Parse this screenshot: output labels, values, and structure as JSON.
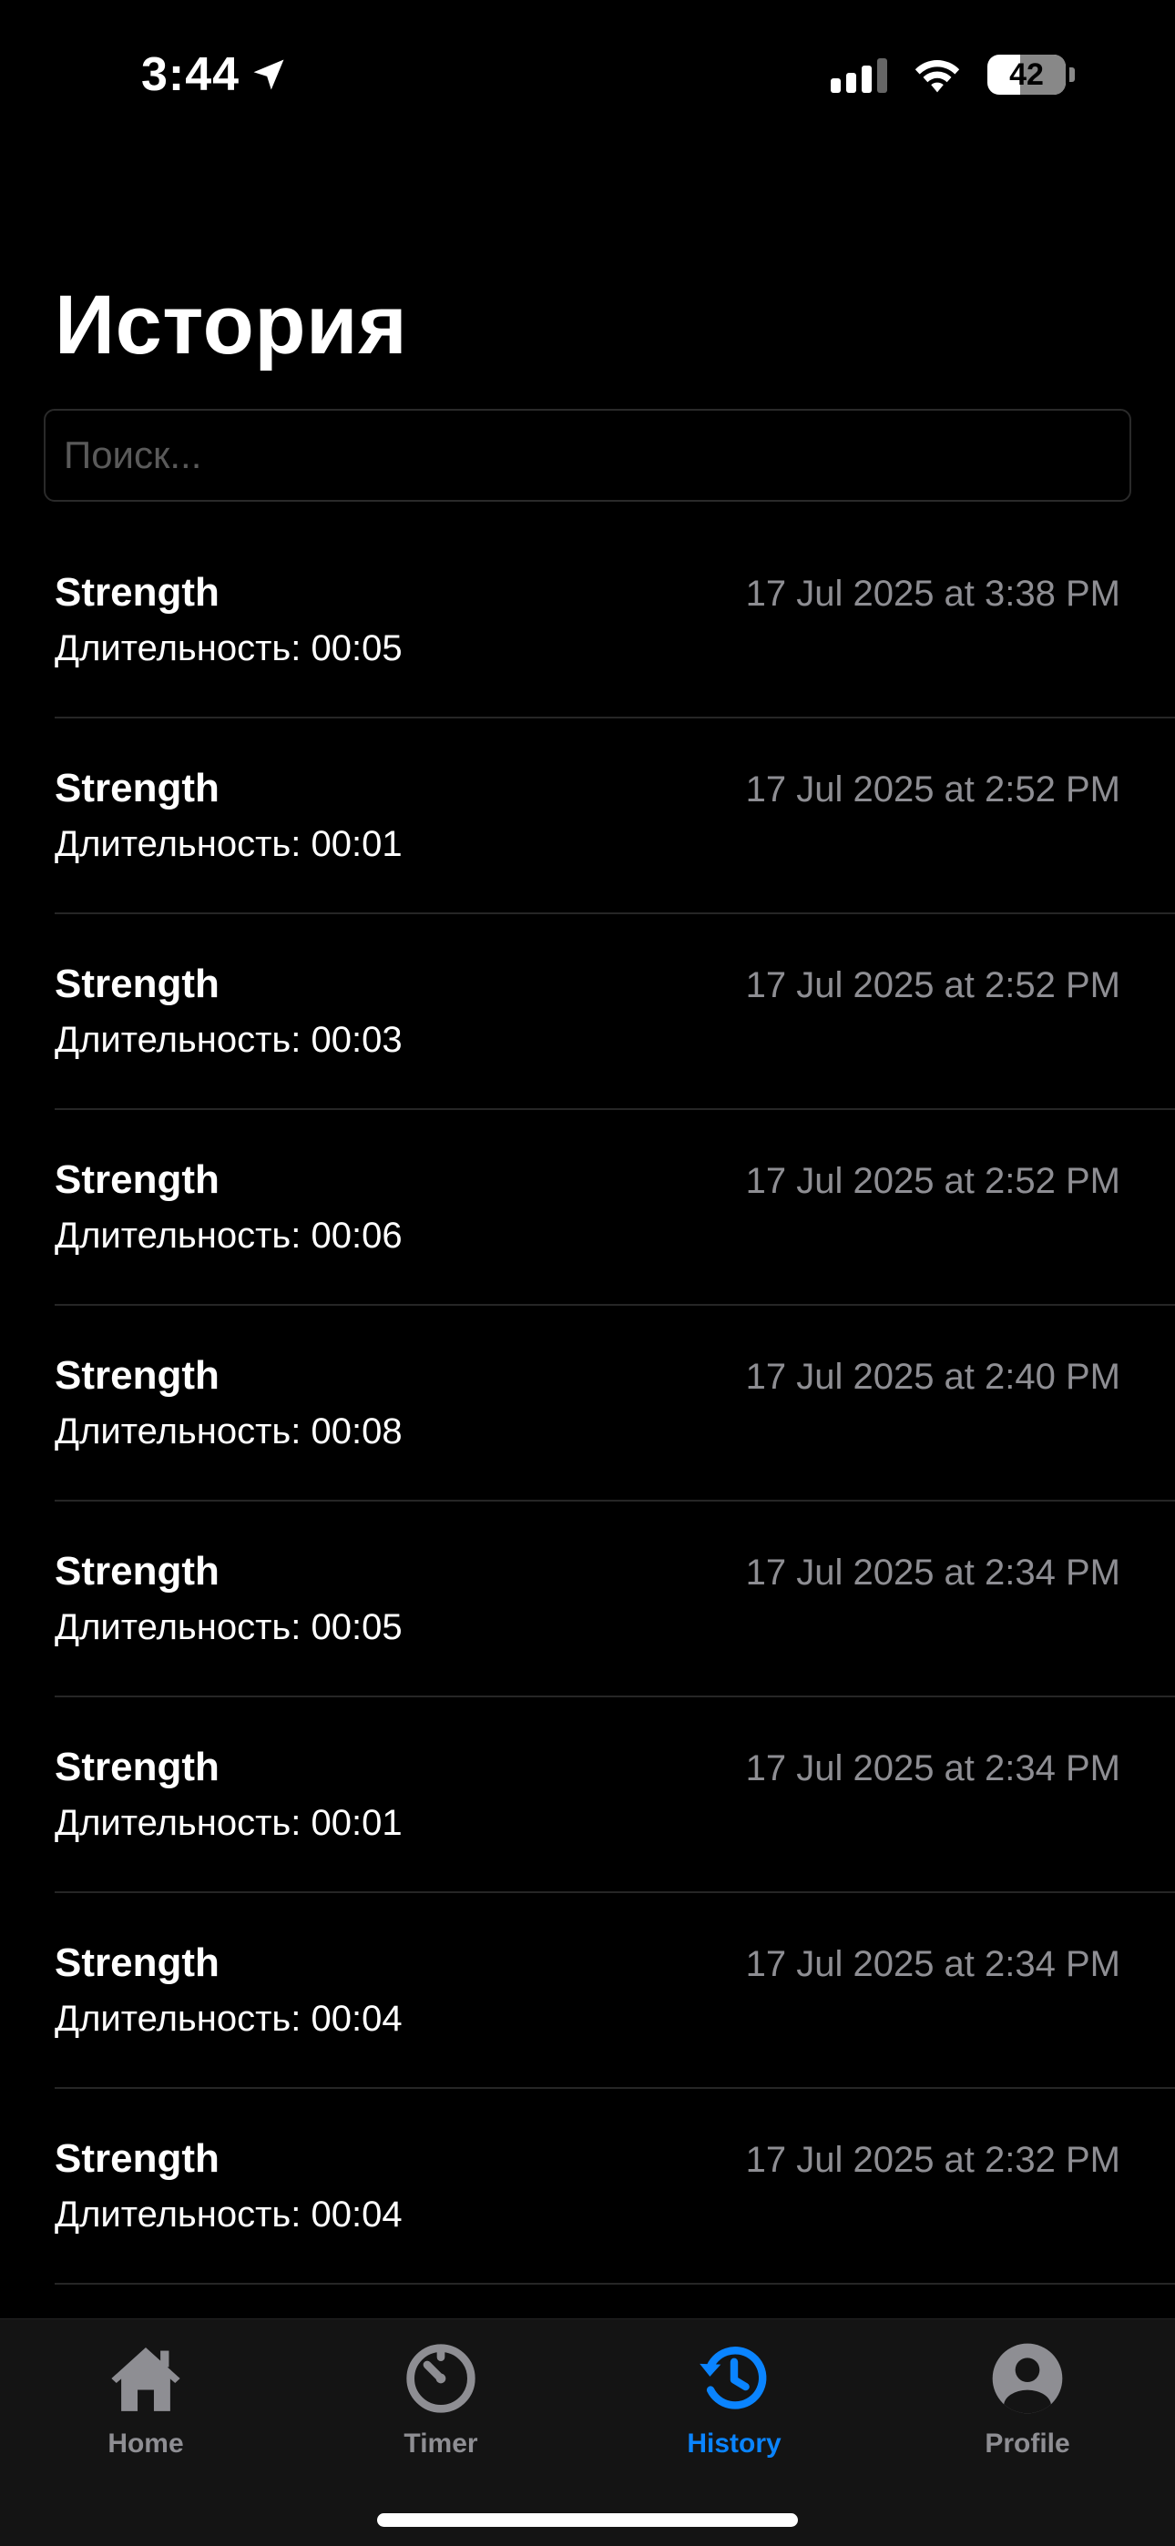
{
  "status_bar": {
    "time": "3:44",
    "battery": "42"
  },
  "page": {
    "title": "История"
  },
  "search": {
    "placeholder": "Поиск..."
  },
  "history": [
    {
      "title": "Strength",
      "duration": "Длительность: 00:05",
      "date": "17 Jul 2025 at 3:38 PM"
    },
    {
      "title": "Strength",
      "duration": "Длительность: 00:01",
      "date": "17 Jul 2025 at 2:52 PM"
    },
    {
      "title": "Strength",
      "duration": "Длительность: 00:03",
      "date": "17 Jul 2025 at 2:52 PM"
    },
    {
      "title": "Strength",
      "duration": "Длительность: 00:06",
      "date": "17 Jul 2025 at 2:52 PM"
    },
    {
      "title": "Strength",
      "duration": "Длительность: 00:08",
      "date": "17 Jul 2025 at 2:40 PM"
    },
    {
      "title": "Strength",
      "duration": "Длительность: 00:05",
      "date": "17 Jul 2025 at 2:34 PM"
    },
    {
      "title": "Strength",
      "duration": "Длительность: 00:01",
      "date": "17 Jul 2025 at 2:34 PM"
    },
    {
      "title": "Strength",
      "duration": "Длительность: 00:04",
      "date": "17 Jul 2025 at 2:34 PM"
    },
    {
      "title": "Strength",
      "duration": "Длительность: 00:04",
      "date": "17 Jul 2025 at 2:32 PM"
    }
  ],
  "tab_bar": {
    "tabs": [
      {
        "label": "Home",
        "icon": "house-icon"
      },
      {
        "label": "Timer",
        "icon": "timer-icon"
      },
      {
        "label": "History",
        "icon": "history-icon"
      },
      {
        "label": "Profile",
        "icon": "person-circle-icon"
      }
    ],
    "active": "History"
  },
  "colors": {
    "background": "#000000",
    "accent": "#0a84ff",
    "secondary_text": "#8e8e93",
    "separator": "#262626",
    "tab_bar": "#141414"
  }
}
